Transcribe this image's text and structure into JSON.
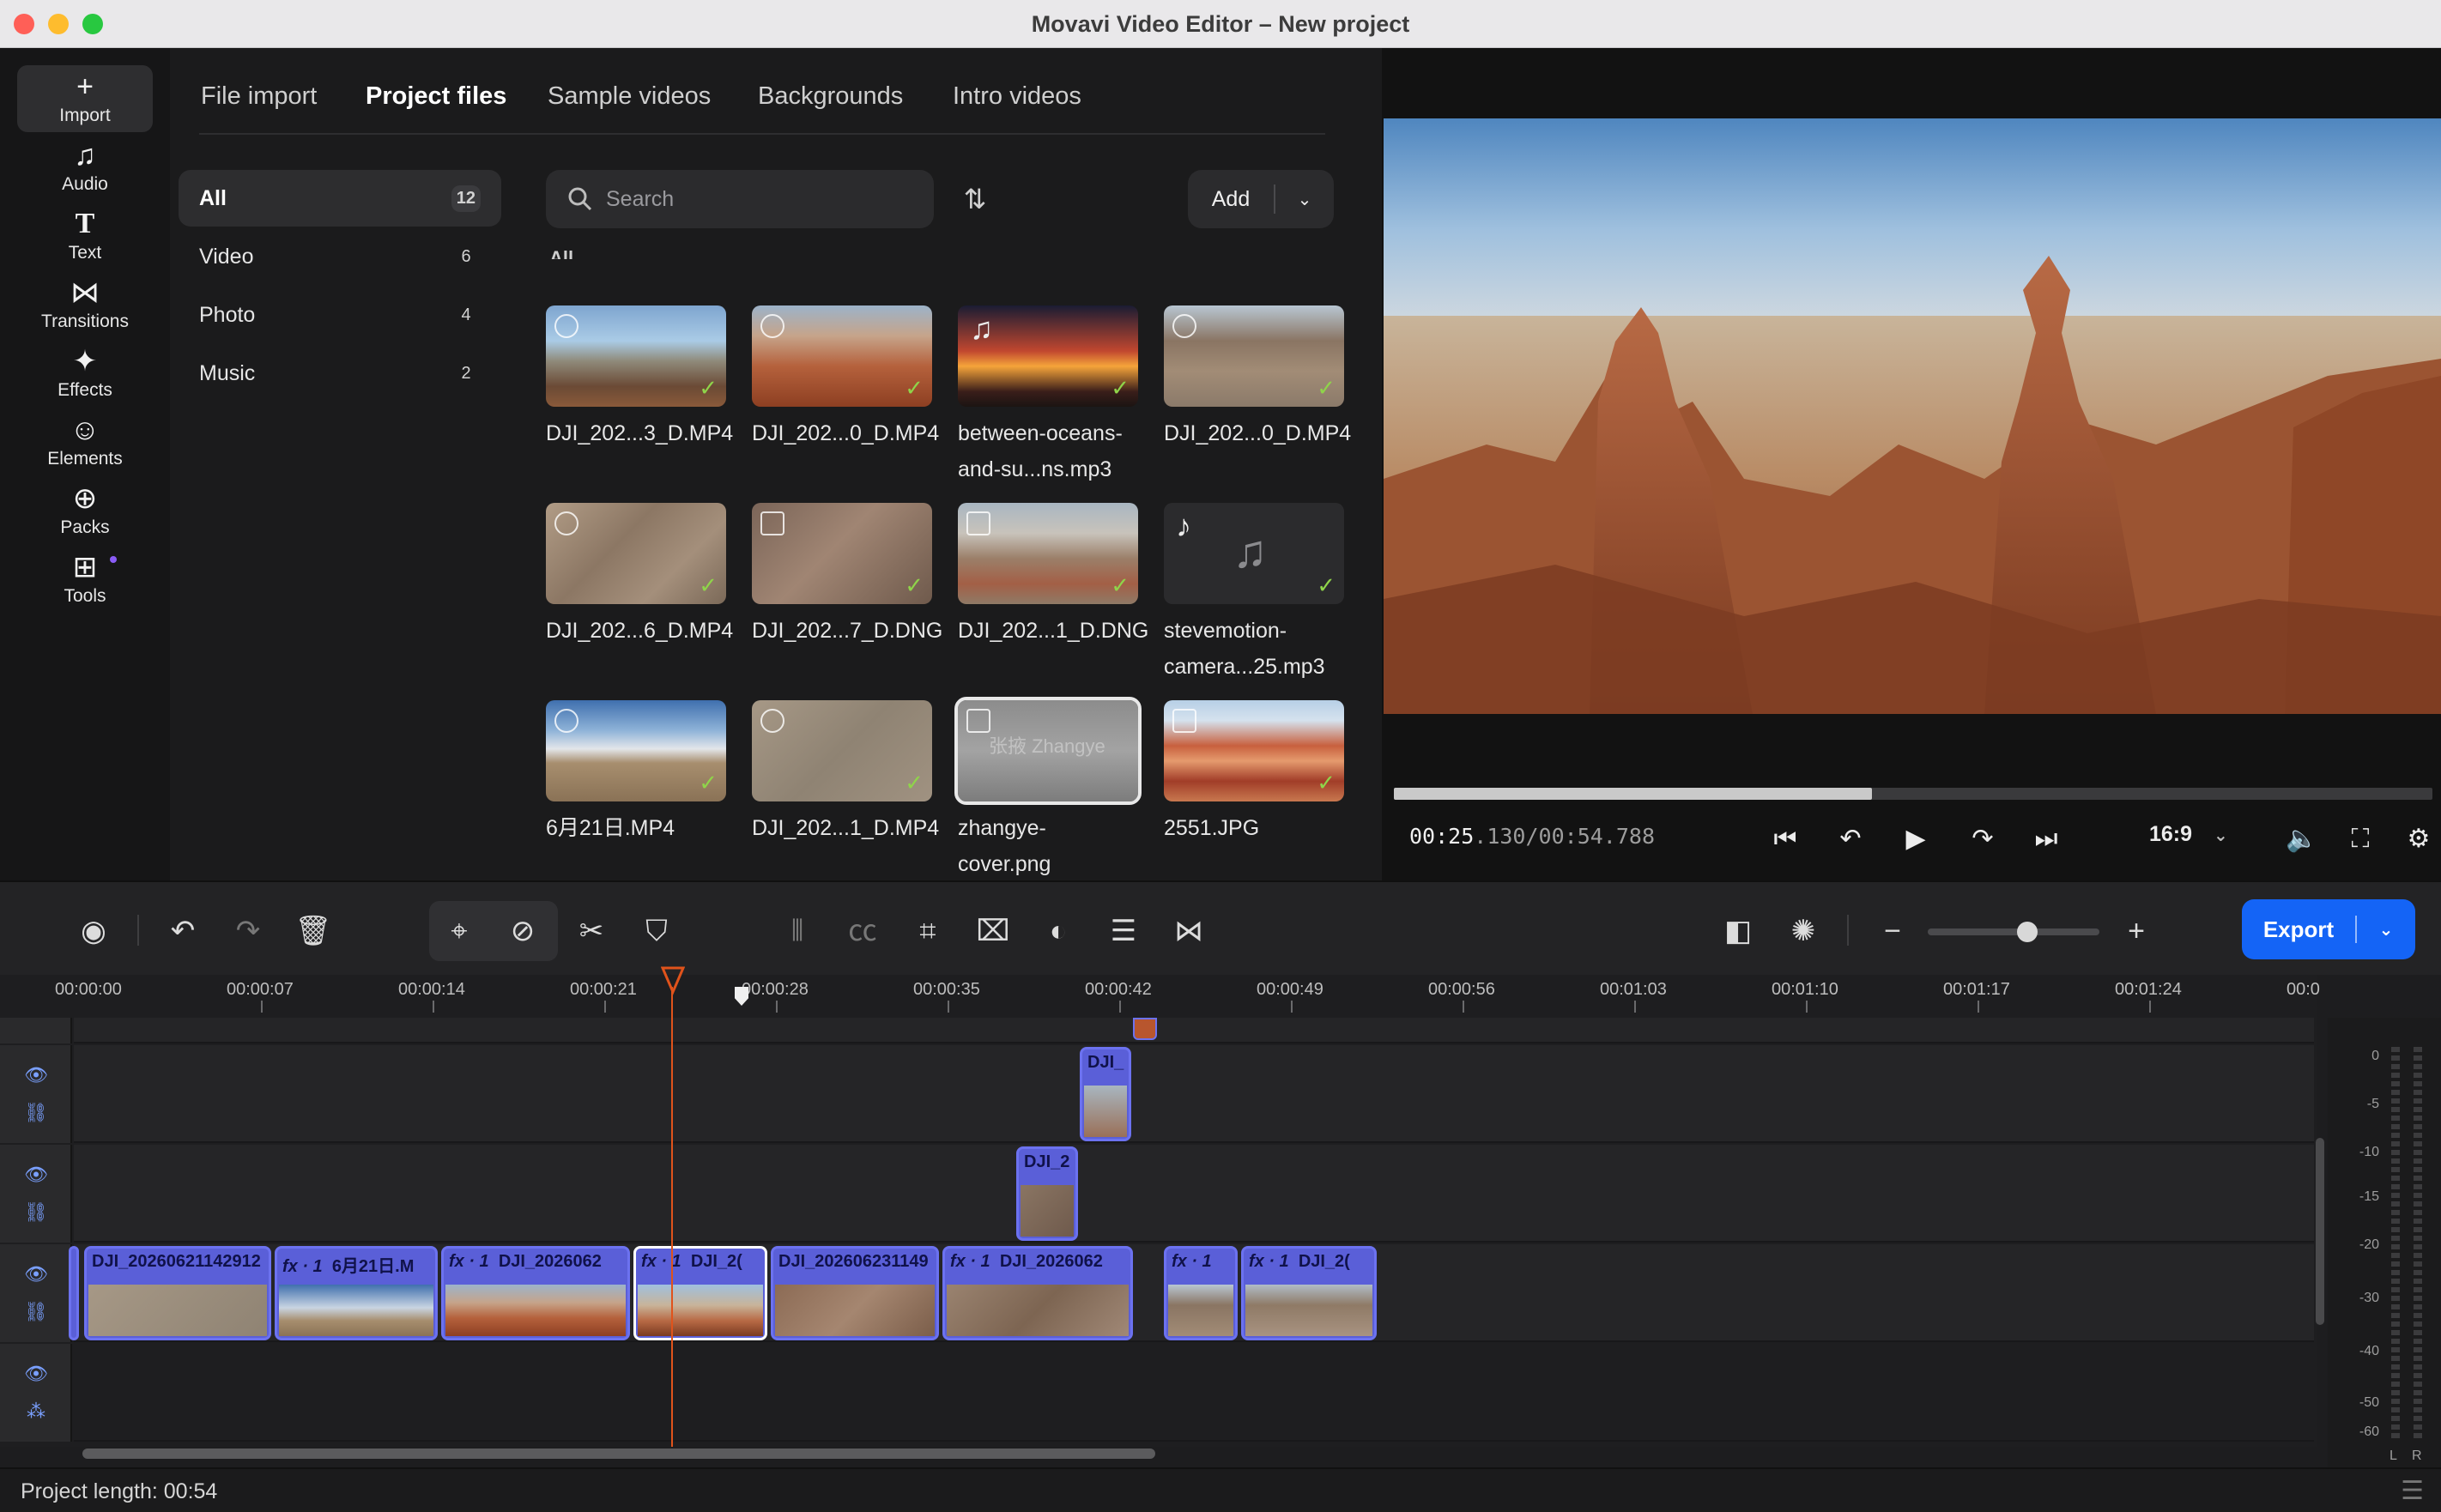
{
  "window": {
    "title": "Movavi Video Editor – New project"
  },
  "nav": [
    {
      "label": "Import",
      "icon": "plus-icon"
    },
    {
      "label": "Audio",
      "icon": "music-note-icon"
    },
    {
      "label": "Text",
      "icon": "text-icon"
    },
    {
      "label": "Transitions",
      "icon": "bowtie-icon"
    },
    {
      "label": "Effects",
      "icon": "sparkle-icon"
    },
    {
      "label": "Elements",
      "icon": "smiley-icon"
    },
    {
      "label": "Packs",
      "icon": "bag-icon"
    },
    {
      "label": "Tools",
      "icon": "grid-plus-icon"
    }
  ],
  "library": {
    "tabs": [
      "File import",
      "Project files",
      "Sample videos",
      "Backgrounds",
      "Intro videos"
    ],
    "active_tab": "Project files",
    "categories": [
      {
        "label": "All",
        "count": "12"
      },
      {
        "label": "Video",
        "count": "6"
      },
      {
        "label": "Photo",
        "count": "4"
      },
      {
        "label": "Music",
        "count": "2"
      }
    ],
    "search_placeholder": "Search",
    "add_label": "Add",
    "section_label": "All",
    "items": [
      {
        "name": "DJI_202...3_D.MP4",
        "kind": "video"
      },
      {
        "name": "DJI_202...0_D.MP4",
        "kind": "video"
      },
      {
        "name": "between-oceans-and-su...ns.mp3",
        "kind": "music"
      },
      {
        "name": "DJI_202...0_D.MP4",
        "kind": "video"
      },
      {
        "name": "DJI_202...6_D.MP4",
        "kind": "video"
      },
      {
        "name": "DJI_202...7_D.DNG",
        "kind": "photo"
      },
      {
        "name": "DJI_202...1_D.DNG",
        "kind": "photo"
      },
      {
        "name": "stevemotion-camera...25.mp3",
        "kind": "music"
      },
      {
        "name": "6月21日.MP4",
        "kind": "video"
      },
      {
        "name": "DJI_202...1_D.MP4",
        "kind": "video"
      },
      {
        "name": "zhangye-cover.png",
        "kind": "photo",
        "overlay_text": "张掖 Zhangye"
      },
      {
        "name": "2551.JPG",
        "kind": "photo"
      }
    ]
  },
  "preview": {
    "current_time": "00:25",
    "current_ms": ".130",
    "total_time": "/00:54.788",
    "progress_fraction": 0.46,
    "aspect_ratio": "16:9"
  },
  "toolbar": {
    "export_label": "Export"
  },
  "timeline": {
    "ruler": [
      "00:00:00",
      "00:00:07",
      "00:00:14",
      "00:00:21",
      "00:00:28",
      "00:00:35",
      "00:00:42",
      "00:00:49",
      "00:00:56",
      "00:01:03",
      "00:01:10",
      "00:01:17",
      "00:01:24",
      "00:0"
    ],
    "overlay_clips": [
      "DJI_",
      "DJI_2"
    ],
    "main_clips": [
      {
        "label": "DJI_20260621142912",
        "fx": ""
      },
      {
        "label": "6月21日.M",
        "fx": "fx · 1"
      },
      {
        "label": "DJI_2026062",
        "fx": "fx · 1"
      },
      {
        "label": "DJI_2(",
        "fx": "fx · 1"
      },
      {
        "label": "DJI_202606231149",
        "fx": ""
      },
      {
        "label": "DJI_2026062",
        "fx": "fx · 1"
      },
      {
        "label": "",
        "fx": "fx · 1"
      },
      {
        "label": "DJI_2(",
        "fx": "fx · 1"
      }
    ]
  },
  "meter": {
    "labels": [
      "0",
      "-5",
      "-10",
      "-15",
      "-20",
      "-30",
      "-40",
      "-50",
      "-60"
    ],
    "channels": [
      "L",
      "R"
    ]
  },
  "status": {
    "project_length": "Project length: 00:54"
  },
  "colors": {
    "accent": "#1464f6",
    "playhead": "#e0531b",
    "clip": "#5a5fd8"
  }
}
